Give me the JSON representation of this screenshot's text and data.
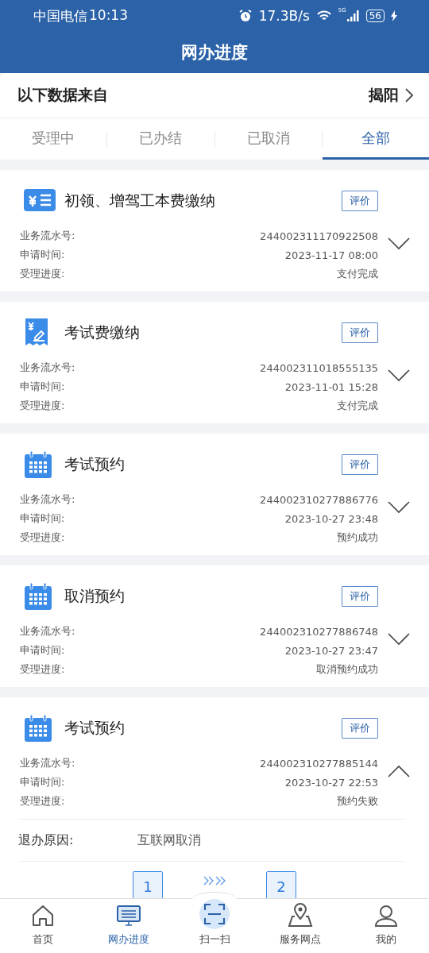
{
  "status_bar": {
    "carrier": "中国电信",
    "time": "10:13",
    "speed": "17.3B/s",
    "network": "5G",
    "battery": "56"
  },
  "header": {
    "title": "网办进度"
  },
  "region": {
    "label": "以下数据来自",
    "value": "揭阳"
  },
  "tabs": [
    {
      "label": "受理中",
      "selected": false
    },
    {
      "label": "已办结",
      "selected": false
    },
    {
      "label": "已取消",
      "selected": false
    },
    {
      "label": "全部",
      "selected": true
    }
  ],
  "records": [
    {
      "kind": "fee",
      "title": "初领、增驾工本费缴纳",
      "rate_button": "评价",
      "expanded": false,
      "fields": [
        {
          "label": "业务流水号:",
          "value": "244002311170922508"
        },
        {
          "label": "申请时间:",
          "value": "2023-11-17 08:00"
        },
        {
          "label": "受理进度:",
          "value": "支付完成"
        }
      ]
    },
    {
      "kind": "receipt",
      "title": "考试费缴纳",
      "rate_button": "评价",
      "expanded": false,
      "fields": [
        {
          "label": "业务流水号:",
          "value": "244002311018555135"
        },
        {
          "label": "申请时间:",
          "value": "2023-11-01 15:28"
        },
        {
          "label": "受理进度:",
          "value": "支付完成"
        }
      ]
    },
    {
      "kind": "calendar",
      "title": "考试预约",
      "rate_button": "评价",
      "expanded": false,
      "fields": [
        {
          "label": "业务流水号:",
          "value": "244002310277886776"
        },
        {
          "label": "申请时间:",
          "value": "2023-10-27 23:48"
        },
        {
          "label": "受理进度:",
          "value": "预约成功"
        }
      ]
    },
    {
      "kind": "calendar",
      "title": "取消预约",
      "rate_button": "评价",
      "expanded": false,
      "fields": [
        {
          "label": "业务流水号:",
          "value": "244002310277886748"
        },
        {
          "label": "申请时间:",
          "value": "2023-10-27 23:47"
        },
        {
          "label": "受理进度:",
          "value": "取消预约成功"
        }
      ]
    },
    {
      "kind": "calendar",
      "title": "考试预约",
      "rate_button": "评价",
      "expanded": true,
      "fields": [
        {
          "label": "业务流水号:",
          "value": "244002310277885144"
        },
        {
          "label": "申请时间:",
          "value": "2023-10-27 22:53"
        },
        {
          "label": "受理进度:",
          "value": "预约失败"
        }
      ],
      "reason": {
        "label": "退办原因:",
        "value": "互联网取消"
      },
      "steps": [
        "1",
        "2"
      ]
    }
  ],
  "bottom_nav": [
    {
      "kind": "home",
      "label": "首页",
      "selected": false
    },
    {
      "kind": "monitor",
      "label": "网办进度",
      "selected": true
    },
    {
      "kind": "scan",
      "label": "扫一扫",
      "selected": false
    },
    {
      "kind": "map",
      "label": "服务网点",
      "selected": false
    },
    {
      "kind": "user",
      "label": "我的",
      "selected": false
    }
  ]
}
